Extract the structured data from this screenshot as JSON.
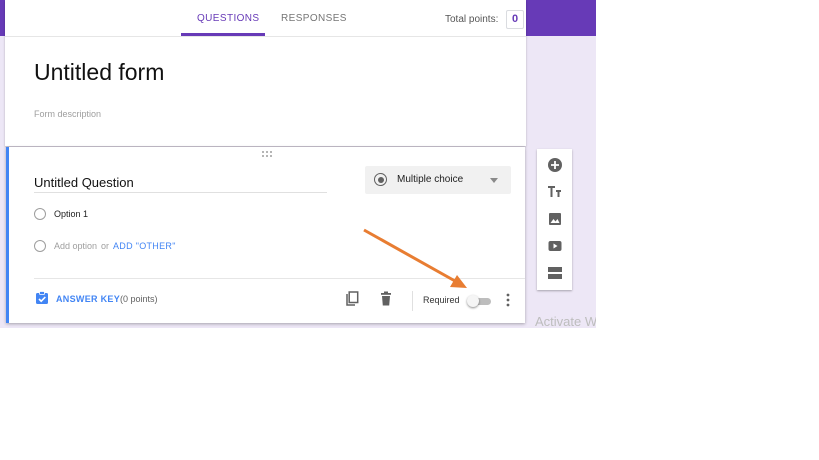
{
  "header": {
    "tabs": [
      {
        "label": "QUESTIONS",
        "active": true
      },
      {
        "label": "RESPONSES",
        "active": false
      }
    ],
    "total_points_label": "Total points:",
    "total_points_value": "0"
  },
  "form": {
    "title": "Untitled form",
    "description_placeholder": "Form description"
  },
  "question": {
    "title": "Untitled Question",
    "type_selected": "Multiple choice",
    "options": [
      {
        "label": "Option 1"
      }
    ],
    "add_option_label": "Add option",
    "or_label": "or",
    "add_other_label": "ADD \"OTHER\"",
    "answer_key_label": "ANSWER KEY",
    "points_label": "(0 points)",
    "required_label": "Required",
    "required_on": false
  },
  "side_toolbar": {
    "icons": [
      "add-question-icon",
      "add-title-icon",
      "add-image-icon",
      "add-video-icon",
      "add-section-icon"
    ]
  },
  "watermark": {
    "text": "Activate Windows"
  },
  "colors": {
    "brand": "#673ab7",
    "accent_blue": "#4285f4",
    "annotation_arrow": "#e87d32",
    "background_lilac": "#ede7f6"
  }
}
